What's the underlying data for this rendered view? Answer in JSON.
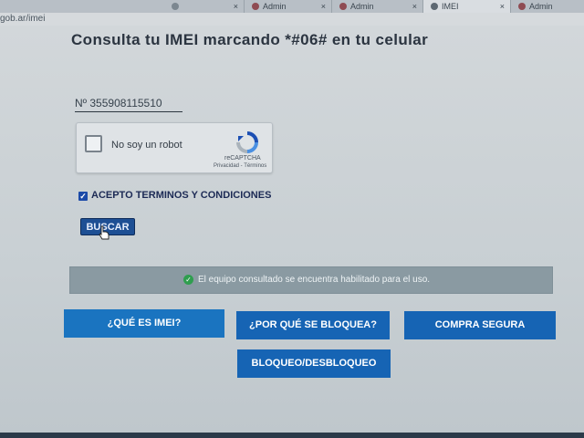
{
  "browser": {
    "tabs": [
      {
        "label": "Admin",
        "close": "×"
      },
      {
        "label": "Admin",
        "close": "×"
      },
      {
        "label": "IMEI",
        "close": "×"
      },
      {
        "label": "Admin",
        "close": ""
      }
    ],
    "url": "gob.ar/imei"
  },
  "page": {
    "heading": "Consulta tu IMEI marcando *#06# en tu celular",
    "imei_value": "Nº 355908115510",
    "captcha": {
      "label": "No soy un robot",
      "brand": "reCAPTCHA",
      "links": "Privacidad - Términos"
    },
    "terms": {
      "checkmark": "✓",
      "label": "ACEPTO TERMINOS Y CONDICIONES"
    },
    "search_button": "BUSCAR",
    "status": {
      "icon": "check-circle-icon",
      "text": "El equipo consultado se encuentra habilitado para el uso."
    },
    "actions": [
      {
        "label": "¿QUÉ ES IMEI?"
      },
      {
        "label": "¿POR QUÉ SE BLOQUEA?"
      },
      {
        "label": "COMPRA SEGURA"
      },
      {
        "label": "BLOQUEO/DESBLOQUEO"
      }
    ]
  },
  "colors": {
    "primary_button": "#1664b4",
    "status_bg": "#8a9aa2",
    "success": "#2f9e4f"
  }
}
